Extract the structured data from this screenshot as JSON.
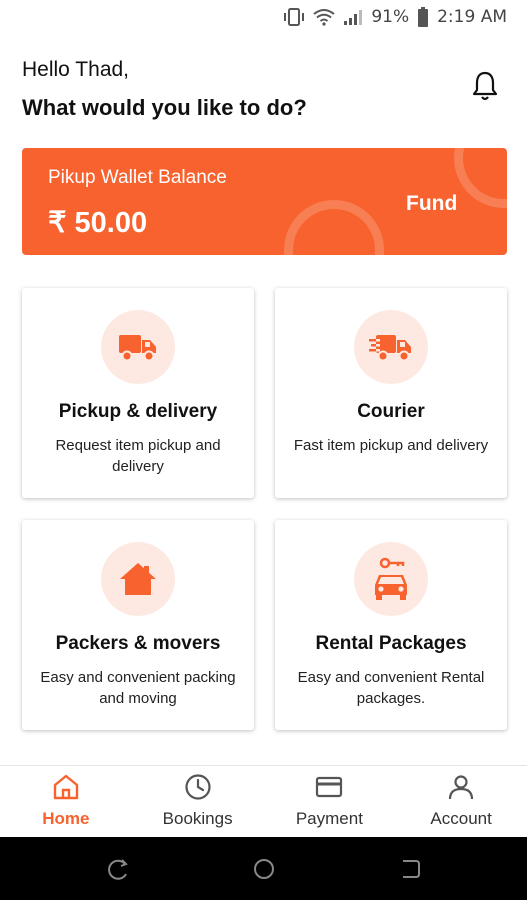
{
  "status_bar": {
    "battery": "91%",
    "time": "2:19 AM"
  },
  "header": {
    "greeting": "Hello Thad,",
    "prompt": "What would you like to do?"
  },
  "wallet": {
    "label": "Pikup Wallet Balance",
    "balance": "₹ 50.00",
    "fund_label": "Fund"
  },
  "services": [
    {
      "title": "Pickup & delivery",
      "desc": "Request item pickup and delivery",
      "icon": "truck-icon"
    },
    {
      "title": "Courier",
      "desc": "Fast item pickup and delivery",
      "icon": "fast-truck-icon"
    },
    {
      "title": "Packers & movers",
      "desc": "Easy and convenient packing and moving",
      "icon": "home-icon"
    },
    {
      "title": "Rental Packages",
      "desc": "Easy and convenient Rental packages.",
      "icon": "car-key-icon"
    }
  ],
  "bottom_nav": [
    {
      "label": "Home",
      "icon": "home-icon",
      "active": true
    },
    {
      "label": "Bookings",
      "icon": "clock-icon",
      "active": false
    },
    {
      "label": "Payment",
      "icon": "card-icon",
      "active": false
    },
    {
      "label": "Account",
      "icon": "user-icon",
      "active": false
    }
  ],
  "colors": {
    "accent": "#f7622f",
    "icon_bg": "#fde9e2"
  }
}
